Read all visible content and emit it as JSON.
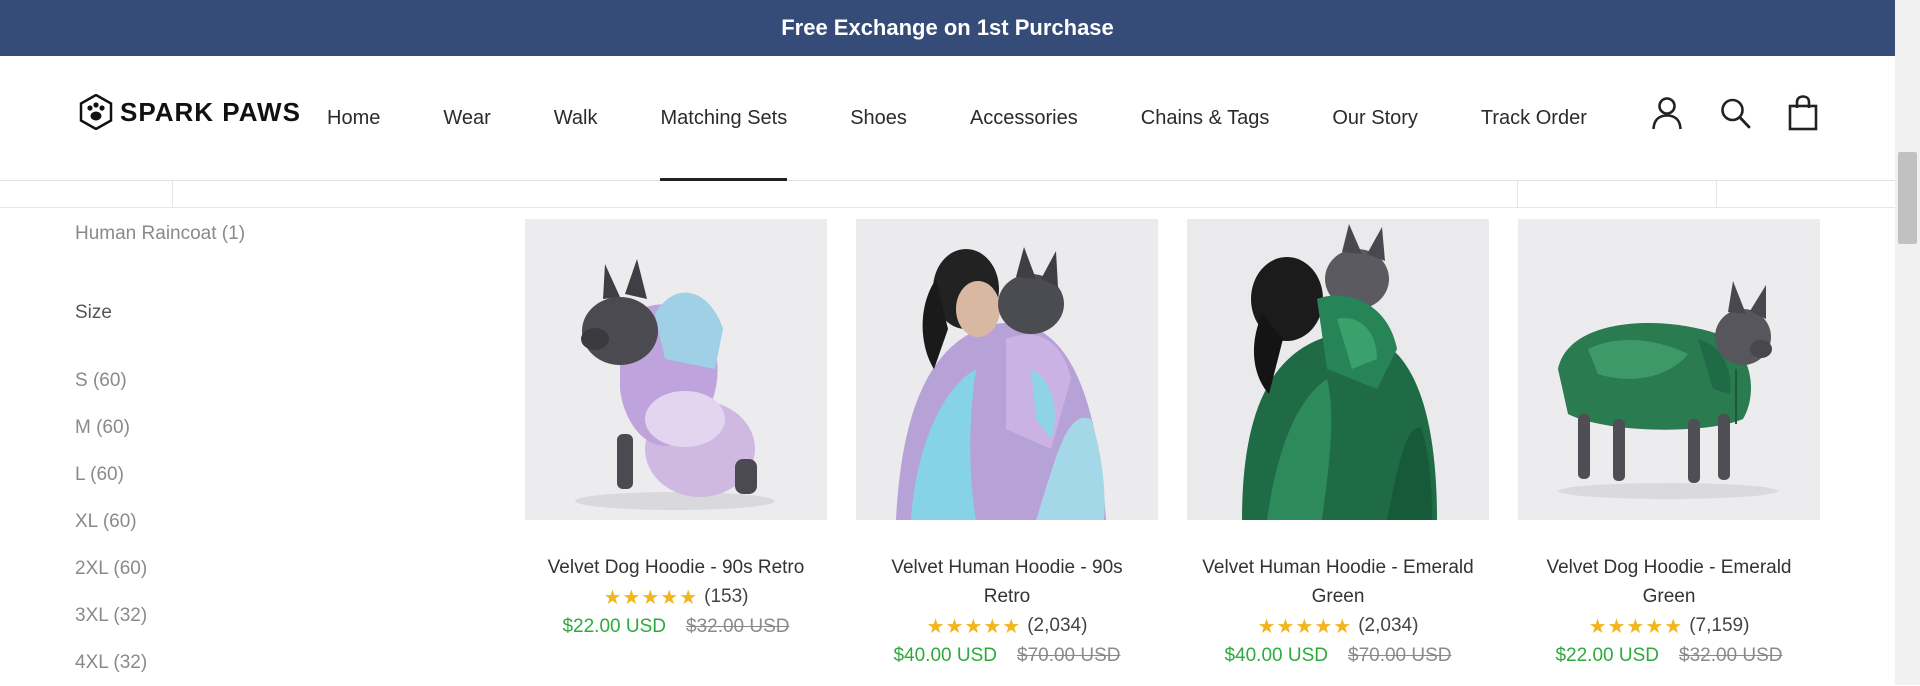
{
  "announcement": {
    "text": "Free Exchange on 1st Purchase"
  },
  "brand": {
    "name": "SPARK PAWS"
  },
  "nav": {
    "items": [
      {
        "label": "Home"
      },
      {
        "label": "Wear"
      },
      {
        "label": "Walk"
      },
      {
        "label": "Matching Sets",
        "active": true
      },
      {
        "label": "Shoes"
      },
      {
        "label": "Accessories"
      },
      {
        "label": "Chains & Tags"
      },
      {
        "label": "Our Story"
      },
      {
        "label": "Track Order"
      }
    ]
  },
  "header_icons": [
    "account-icon",
    "search-icon",
    "bag-icon"
  ],
  "sidebar": {
    "previous_filter": "Human Raincoat (1)",
    "size_title": "Size",
    "sizes": [
      {
        "label": "S (60)"
      },
      {
        "label": "M (60)"
      },
      {
        "label": "L (60)"
      },
      {
        "label": "XL (60)"
      },
      {
        "label": "2XL (60)"
      },
      {
        "label": "3XL (32)"
      },
      {
        "label": "4XL (32)"
      }
    ]
  },
  "products": [
    {
      "title": "Velvet Dog Hoodie - 90s Retro",
      "stars": "★★★★★",
      "reviews": "(153)",
      "price": "$22.00 USD",
      "compare": "$32.00 USD"
    },
    {
      "title": "Velvet Human Hoodie - 90s Retro",
      "stars": "★★★★★",
      "reviews": "(2,034)",
      "price": "$40.00 USD",
      "compare": "$70.00 USD"
    },
    {
      "title": "Velvet Human Hoodie - Emerald Green",
      "stars": "★★★★★",
      "reviews": "(2,034)",
      "price": "$40.00 USD",
      "compare": "$70.00 USD"
    },
    {
      "title": "Velvet Dog Hoodie - Emerald Green",
      "stars": "★★★★★",
      "reviews": "(7,159)",
      "price": "$22.00 USD",
      "compare": "$32.00 USD"
    }
  ],
  "colors": {
    "announcement_bg": "#354c79",
    "price_green": "#2eaa3d",
    "star_gold": "#f2b51c",
    "retro_purple": "#c9a9e0",
    "retro_cyan": "#7ed3e6",
    "emerald": "#1f6b45"
  }
}
